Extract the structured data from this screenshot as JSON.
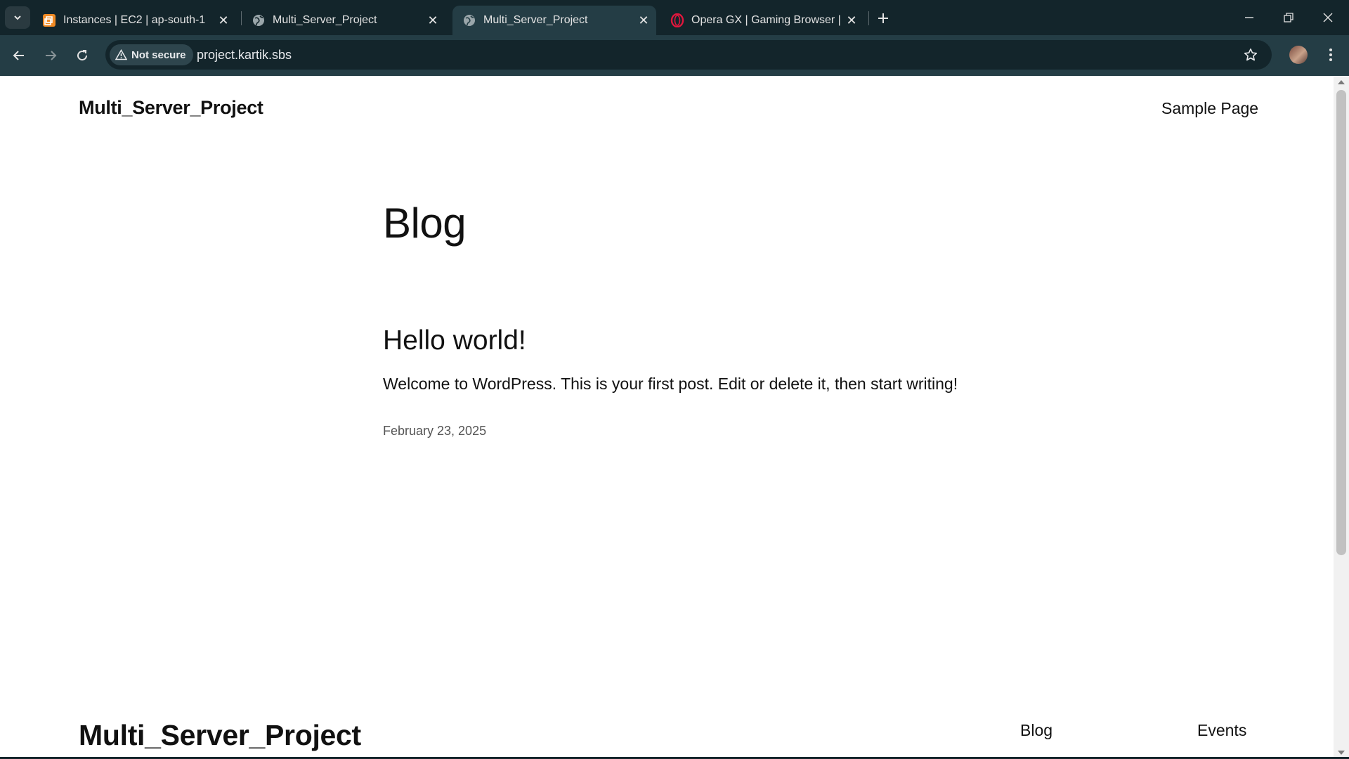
{
  "browser": {
    "tabs": [
      {
        "title": "Instances | EC2 | ap-south-1",
        "icon": "aws-icon",
        "active": false
      },
      {
        "title": "Multi_Server_Project",
        "icon": "globe-icon",
        "active": false
      },
      {
        "title": "Multi_Server_Project",
        "icon": "globe-icon",
        "active": true
      },
      {
        "title": "Opera GX | Gaming Browser | O",
        "icon": "opera-icon",
        "active": false
      }
    ],
    "security_chip": "Not secure",
    "url": "project.kartik.sbs",
    "colors": {
      "frame": "#13252b",
      "toolbar": "#243d45",
      "aws": "#f08a24",
      "opera": "#e0173d"
    }
  },
  "site": {
    "title": "Multi_Server_Project",
    "nav": {
      "sample_page": "Sample Page"
    },
    "page_heading": "Blog",
    "post": {
      "title": "Hello world!",
      "excerpt": "Welcome to WordPress. This is your first post. Edit or delete it, then start writing!",
      "date": "February 23, 2025"
    },
    "footer": {
      "title": "Multi_Server_Project",
      "links": [
        "Blog",
        "Events"
      ]
    }
  }
}
